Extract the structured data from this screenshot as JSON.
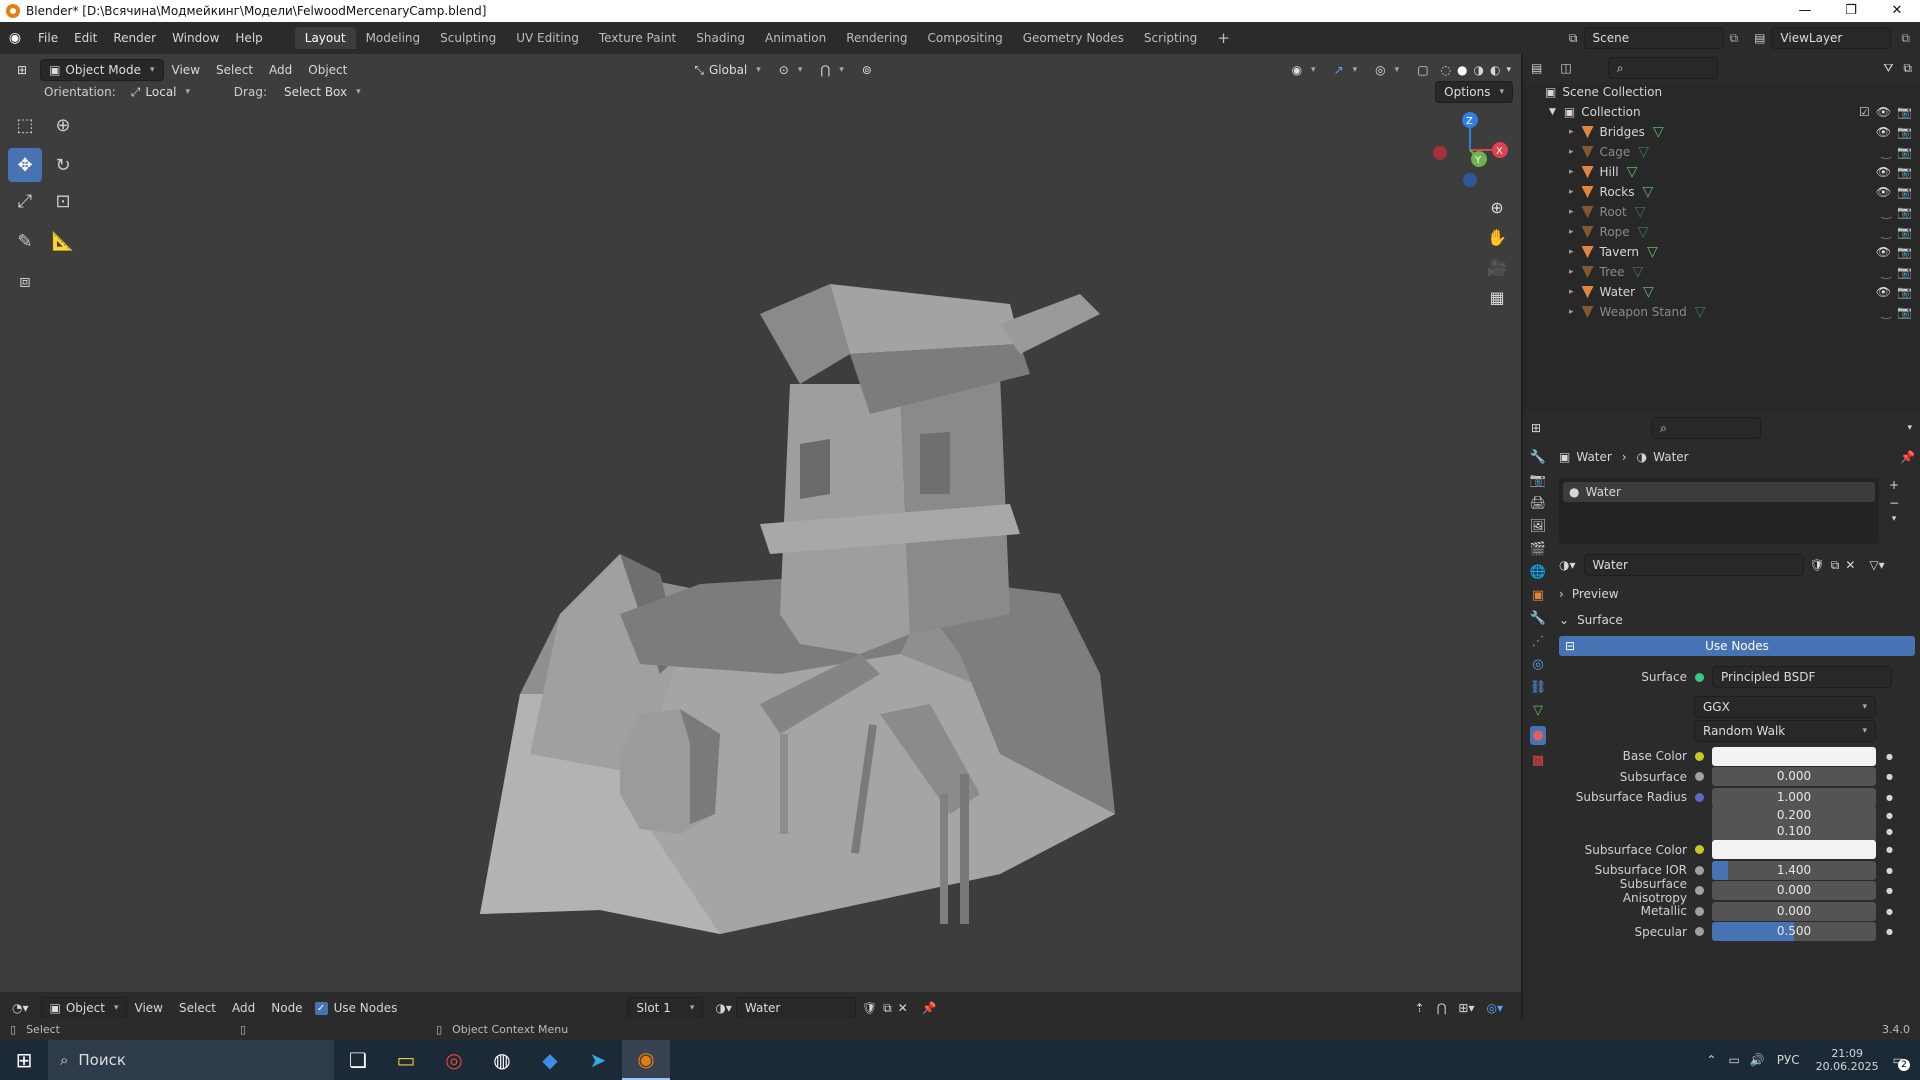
{
  "window": {
    "title": "Blender* [D:\\Всячина\\Модмейкинг\\Модели\\FelwoodMercenaryCamp.blend]",
    "controls": [
      "—",
      "❐",
      "✕"
    ]
  },
  "menu": {
    "items": [
      "File",
      "Edit",
      "Render",
      "Window",
      "Help"
    ]
  },
  "workspaces": {
    "tabs": [
      "Layout",
      "Modeling",
      "Sculpting",
      "UV Editing",
      "Texture Paint",
      "Shading",
      "Animation",
      "Rendering",
      "Compositing",
      "Geometry Nodes",
      "Scripting"
    ],
    "active": "Layout",
    "add": "+"
  },
  "scene": {
    "label": "Scene",
    "viewlayer": "ViewLayer"
  },
  "viewport": {
    "mode": "Object Mode",
    "menus": [
      "View",
      "Select",
      "Add",
      "Object"
    ],
    "transform": "Global",
    "orientation_label": "Orientation:",
    "orientation_value": "Local",
    "drag_label": "Drag:",
    "drag_value": "Select Box",
    "options": "Options",
    "gizmo": {
      "x": "X",
      "y": "Y",
      "z": "Z"
    }
  },
  "outliner": {
    "root": "Scene Collection",
    "collection": "Collection",
    "items": [
      {
        "name": "Bridges",
        "visible": true
      },
      {
        "name": "Cage",
        "visible": false
      },
      {
        "name": "Hill",
        "visible": true
      },
      {
        "name": "Rocks",
        "visible": true
      },
      {
        "name": "Root",
        "visible": false
      },
      {
        "name": "Rope",
        "visible": false
      },
      {
        "name": "Tavern",
        "visible": true
      },
      {
        "name": "Tree",
        "visible": false
      },
      {
        "name": "Water",
        "visible": true
      },
      {
        "name": "Weapon Stand",
        "visible": false
      }
    ]
  },
  "properties": {
    "breadcrumb_object": "Water",
    "breadcrumb_material": "Water",
    "slot_name": "Water",
    "material_name": "Water",
    "sections": {
      "preview": "Preview",
      "surface": "Surface"
    },
    "use_nodes": "Use Nodes",
    "surface_label": "Surface",
    "surface_value": "Principled BSDF",
    "distribution": "GGX",
    "subsurface_method": "Random Walk",
    "fields": [
      {
        "label": "Base Color",
        "value": "",
        "socket": "#c7c729",
        "color": "#f2f2f2",
        "fill": 0
      },
      {
        "label": "Subsurface",
        "value": "0.000",
        "socket": "#a1a1a1",
        "fill": 0
      },
      {
        "label": "Subsurface Radius",
        "value": "1.000",
        "socket": "#6363c7",
        "fill": 0
      },
      {
        "label": "",
        "value": "0.200",
        "socket": "",
        "fill": 0
      },
      {
        "label": "",
        "value": "0.100",
        "socket": "",
        "fill": 0
      },
      {
        "label": "Subsurface Color",
        "value": "",
        "socket": "#c7c729",
        "color": "#f2f2f2",
        "fill": 0
      },
      {
        "label": "Subsurface IOR",
        "value": "1.400",
        "socket": "#a1a1a1",
        "fill": 0.1
      },
      {
        "label": "Subsurface Anisotropy",
        "value": "0.000",
        "socket": "#a1a1a1",
        "fill": 0
      },
      {
        "label": "Metallic",
        "value": "0.000",
        "socket": "#a1a1a1",
        "fill": 0
      },
      {
        "label": "Specular",
        "value": "0.500",
        "socket": "#a1a1a1",
        "fill": 0.5
      }
    ]
  },
  "node_header": {
    "mode": "Object",
    "menus": [
      "View",
      "Select",
      "Add",
      "Node"
    ],
    "use_nodes": "Use Nodes",
    "slot": "Slot 1",
    "material": "Water"
  },
  "status": {
    "left": "Select",
    "middle": "Object Context Menu",
    "version": "3.4.0"
  },
  "taskbar": {
    "search": "Поиск",
    "lang": "РУС",
    "time": "21:09",
    "date": "20.06.2025",
    "notifications": "2"
  },
  "colors": {
    "accent": "#4772b3",
    "object_orange": "#e0853b",
    "mesh_green": "#5fb96b",
    "viewport_bg": "#3d3d3d"
  }
}
